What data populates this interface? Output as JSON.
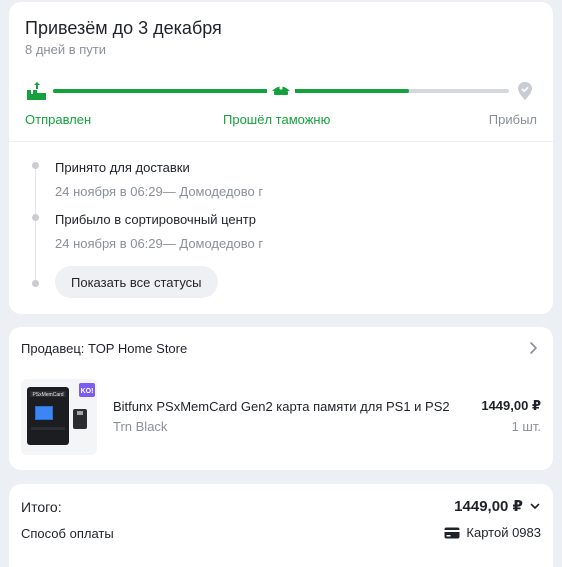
{
  "delivery": {
    "title": "Привезём до 3 декабря",
    "subtitle": "8 дней в пути",
    "progress_fraction": 0.78,
    "stages": [
      {
        "label": "Отправлен",
        "state": "done",
        "icon": "shipped-parcels-icon"
      },
      {
        "label": "Прошёл таможню",
        "state": "done",
        "icon": "customs-officer-cap-icon"
      },
      {
        "label": "Прибыл",
        "state": "pending",
        "icon": "location-pin-check-icon"
      }
    ],
    "events": [
      {
        "title": "Принято для доставки",
        "meta": "24 ноября в 06:29— Домодедово г"
      },
      {
        "title": "Прибыло в сортировочный центр",
        "meta": "24 ноября в 06:29— Домодедово г"
      }
    ],
    "show_all_label": "Показать все статусы"
  },
  "seller": {
    "label": "Продавец: TOP Home Store"
  },
  "product": {
    "name": "Bitfunx PSxMemCard Gen2 карта памяти для PS1 и PS2",
    "variant": "Trn Black",
    "price": "1449,00 ₽",
    "qty": "1 шт.",
    "thumb_device_label": "PSxMemCard",
    "thumb_badge": "KO!"
  },
  "summary": {
    "total_label": "Итого:",
    "total_value": "1449,00 ₽",
    "payment_label": "Способ оплаты",
    "payment_value": "Картой 0983"
  },
  "colors": {
    "accent_green": "#15a23c",
    "muted_gray": "#8a9099",
    "track_gray": "#d5d8de",
    "background": "#eceff3"
  }
}
